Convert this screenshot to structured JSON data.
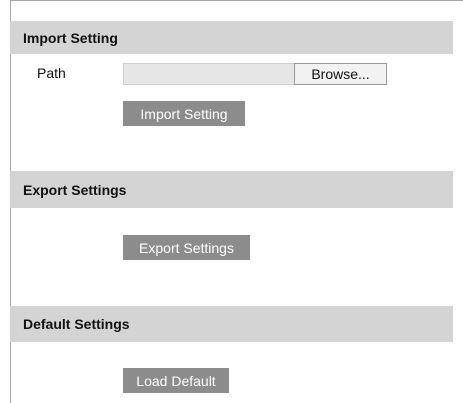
{
  "import": {
    "header": "Import Setting",
    "path_label": "Path",
    "path_value": "",
    "browse_label": "Browse...",
    "button_label": "Import Setting"
  },
  "export": {
    "header": "Export Settings",
    "button_label": "Export Settings"
  },
  "default": {
    "header": "Default Settings",
    "button_label": "Load Default"
  },
  "colors": {
    "section_bar": "#d4d4d4",
    "button_bg": "#8c8c8c",
    "button_text": "#ffffff",
    "input_bg": "#e6e6e6"
  }
}
